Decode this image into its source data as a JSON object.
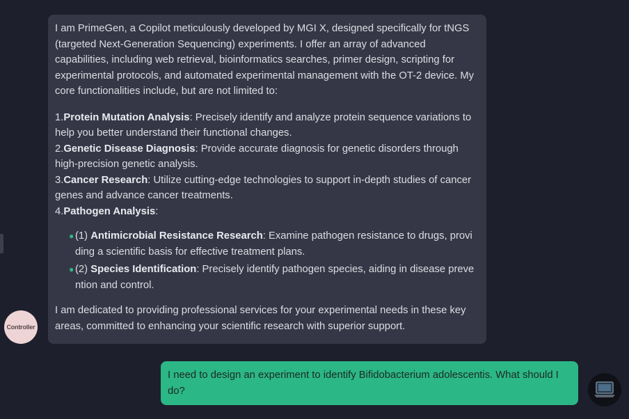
{
  "bot": {
    "avatar_label": "Controller",
    "intro": "I am PrimeGen, a Copilot meticulously developed by MGI X, designed specifically for tNGS (targeted Next-Generation Sequencing) experiments. I offer an array of advanced capabilities, including web retrieval, bioinformatics searches, primer design, scripting for experimental protocols, and automated experimental management with the OT-2 device. My core functionalities include, but are not limited to:",
    "capabilities": [
      {
        "num": "1.",
        "title": "Protein Mutation Analysis",
        "text": ": Precisely identify and analyze protein sequence variations to help you better understand their functional changes."
      },
      {
        "num": "2.",
        "title": "Genetic Disease Diagnosis",
        "text": ": Provide accurate diagnosis for genetic disorders through high-precision genetic analysis."
      },
      {
        "num": "3.",
        "title": "Cancer Research",
        "text": ": Utilize cutting-edge technologies to support in-depth studies of cancer genes and advance cancer treatments."
      },
      {
        "num": "4.",
        "title": "Pathogen Analysis",
        "text": ":"
      }
    ],
    "subitems": [
      {
        "prefix": "(1) ",
        "title": "Antimicrobial Resistance Research",
        "text": ": Examine pathogen resistance to drugs, providing a scientific basis for effective treatment plans."
      },
      {
        "prefix": "(2) ",
        "title": "Species Identification",
        "text": ": Precisely identify pathogen species, aiding in disease prevention and control."
      }
    ],
    "closing": "I am dedicated to providing professional services for your experimental needs in these key areas, committed to enhancing your scientific research with superior support."
  },
  "user": {
    "message": "I need to design an experiment to identify Bifidobacterium adolescentis. What should I do?"
  },
  "colors": {
    "background": "#1e1f2c",
    "bot_bubble": "#363746",
    "user_bubble": "#2bb786",
    "bullet": "#2bb888"
  }
}
